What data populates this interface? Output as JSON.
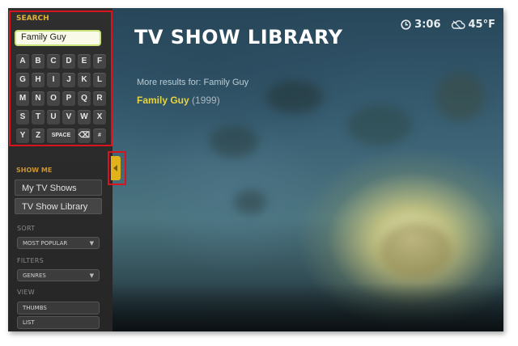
{
  "sidebar": {
    "search_label": "SEARCH",
    "search_value": "Family Guy",
    "keys": [
      [
        "A",
        "B",
        "C",
        "D",
        "E",
        "F"
      ],
      [
        "G",
        "H",
        "I",
        "J",
        "K",
        "L"
      ],
      [
        "M",
        "N",
        "O",
        "P",
        "Q",
        "R"
      ],
      [
        "S",
        "T",
        "U",
        "V",
        "W",
        "X"
      ],
      [
        "Y",
        "Z",
        "SPACE",
        "⌫",
        "#"
      ]
    ],
    "show_me_label": "SHOW ME",
    "show_options": [
      "My TV Shows",
      "TV Show Library"
    ],
    "sort_label": "SORT",
    "sort_value": "MOST POPULAR",
    "filters_label": "FILTERS",
    "filters_value": "GENRES",
    "view_label": "VIEW",
    "view_options": [
      "THUMBS",
      "LIST"
    ]
  },
  "main": {
    "title": "TV SHOW LIBRARY",
    "more_results": "More results for: Family Guy",
    "results": [
      {
        "name": "Family Guy",
        "year": "(1999)"
      }
    ]
  },
  "status": {
    "time": "3:06",
    "temperature": "45°F",
    "clock_icon": "clock-icon",
    "weather_icon": "cloud-icon"
  },
  "colors": {
    "accent": "#e0b23a",
    "highlight": "#e9d43a",
    "annotation_red": "#d8141c"
  }
}
